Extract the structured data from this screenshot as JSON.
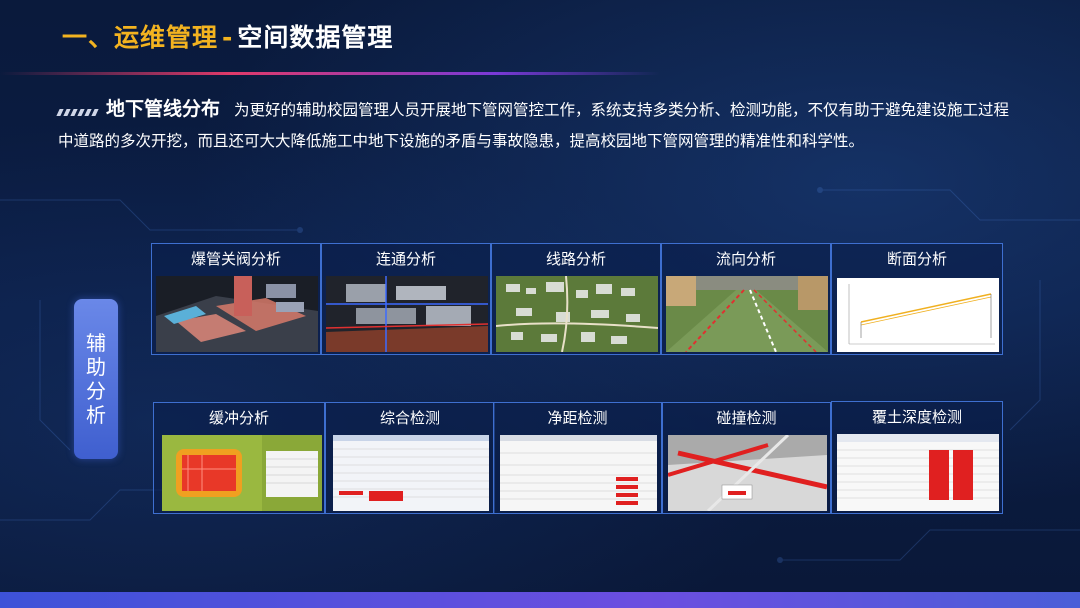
{
  "header": {
    "title_main": "一、运维管理",
    "title_sep": "-",
    "title_sub": "空间数据管理"
  },
  "intro": {
    "heading": "地下管线分布",
    "text": "为更好的辅助校园管理人员开展地下管网管控工作，系统支持多类分析、检测功能，不仅有助于避免建设施工过程中道路的多次开挖，而且还可大大降低施工中地下设施的矛盾与事故隐患，提高校园地下管网管理的精准性和科学性。"
  },
  "side_label": {
    "chars": [
      "辅",
      "助",
      "分",
      "析"
    ]
  },
  "row1": [
    {
      "label": "爆管关阀分析",
      "icon": "pipe-burst-3d-thumbnail"
    },
    {
      "label": "连通分析",
      "icon": "connectivity-3d-thumbnail"
    },
    {
      "label": "线路分析",
      "icon": "route-map-thumbnail"
    },
    {
      "label": "流向分析",
      "icon": "flow-direction-thumbnail"
    },
    {
      "label": "断面分析",
      "icon": "cross-section-chart-thumbnail"
    }
  ],
  "row2": [
    {
      "label": "缓冲分析",
      "icon": "buffer-zone-thumbnail"
    },
    {
      "label": "综合检测",
      "icon": "composite-check-table-thumbnail"
    },
    {
      "label": "净距检测",
      "icon": "clearance-check-table-thumbnail"
    },
    {
      "label": "碰撞检测",
      "icon": "collision-3d-thumbnail"
    },
    {
      "label": "覆土深度检测",
      "icon": "cover-depth-table-thumbnail"
    }
  ],
  "colors": {
    "title_accent": "#f3b320",
    "card_border": "#3e6fd0",
    "side_label": "#5675e0",
    "alert_red": "#e02020"
  }
}
